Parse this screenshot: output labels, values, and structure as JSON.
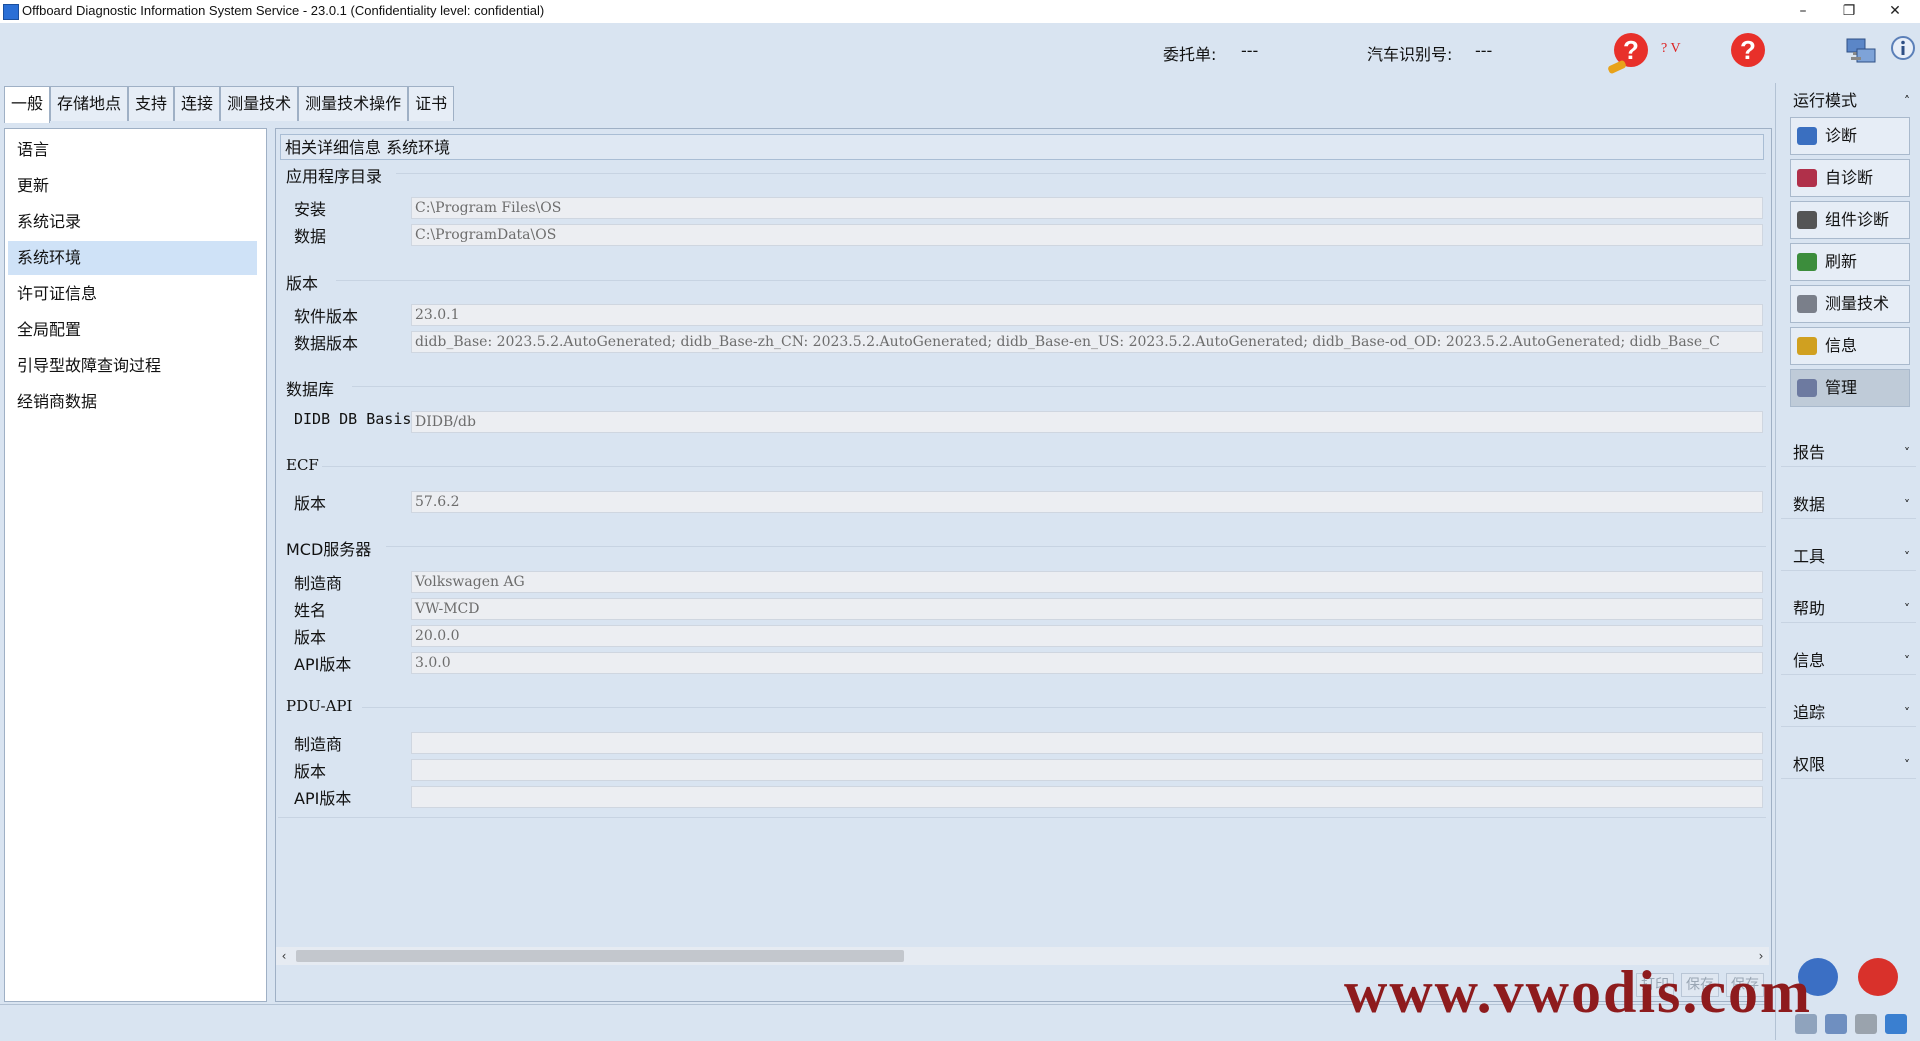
{
  "window": {
    "title": "Offboard Diagnostic Information System Service - 23.0.1 (Confidentiality level: confidential)",
    "minimize": "–",
    "restore": "❐",
    "close": "✕"
  },
  "header": {
    "order_label": "委托单:",
    "order_value": "---",
    "vin_label": "汽车识别号:",
    "vin_value": "---",
    "help_mark": "?",
    "help_suffix": "? V",
    "help2_mark": "?"
  },
  "tabs": [
    "一般",
    "存储地点",
    "支持",
    "连接",
    "测量技术",
    "测量技术操作",
    "证书"
  ],
  "sidebar": {
    "items": [
      "语言",
      "更新",
      "系统记录",
      "系统环境",
      "许可证信息",
      "全局配置",
      "引导型故障查询过程",
      "经销商数据"
    ],
    "active_index": 3
  },
  "main": {
    "breadcrumb": "相关详细信息 系统环境",
    "sections": [
      {
        "title": "应用程序目录",
        "rows": [
          {
            "label": "安装",
            "value": "C:\\Program Files\\OS"
          },
          {
            "label": "数据",
            "value": "C:\\ProgramData\\OS"
          }
        ]
      },
      {
        "title": "版本",
        "rows": [
          {
            "label": "软件版本",
            "value": "23.0.1"
          },
          {
            "label": "数据版本",
            "value": "didb_Base: 2023.5.2.AutoGenerated; didb_Base-zh_CN: 2023.5.2.AutoGenerated; didb_Base-en_US: 2023.5.2.AutoGenerated; didb_Base-od_OD: 2023.5.2.AutoGenerated; didb_Base_C"
          }
        ]
      },
      {
        "title": "数据库",
        "rows": [
          {
            "label": "DIDB DB Basis",
            "value": "DIDB/db"
          }
        ]
      },
      {
        "title": "ECF",
        "rows": [
          {
            "label": "版本",
            "value": "57.6.2"
          }
        ]
      },
      {
        "title": "MCD服务器",
        "rows": [
          {
            "label": "制造商",
            "value": "Volkswagen AG"
          },
          {
            "label": "姓名",
            "value": "VW-MCD"
          },
          {
            "label": "版本",
            "value": "20.0.0"
          },
          {
            "label": "API版本",
            "value": "3.0.0"
          }
        ]
      },
      {
        "title": "PDU-API",
        "rows": [
          {
            "label": "制造商",
            "value": ""
          },
          {
            "label": "版本",
            "value": ""
          },
          {
            "label": "API版本",
            "value": ""
          }
        ]
      }
    ],
    "scroll_left": "‹",
    "scroll_right": "›",
    "bottom_buttons": [
      "打印",
      "保存",
      "保存"
    ]
  },
  "right_panel": {
    "mode_header": "运行模式",
    "collapse_caret": "˄",
    "mode_buttons": [
      {
        "label": "诊断",
        "icon": "diagnosis-icon",
        "color": "#3a6fc0"
      },
      {
        "label": "自诊断",
        "icon": "self-diagnosis-icon",
        "color": "#b0304a"
      },
      {
        "label": "组件诊断",
        "icon": "component-diagnosis-icon",
        "color": "#555555"
      },
      {
        "label": "刷新",
        "icon": "flash-icon",
        "color": "#3c8d3c"
      },
      {
        "label": "测量技术",
        "icon": "measurement-icon",
        "color": "#7a7f8a"
      },
      {
        "label": "信息",
        "icon": "info-book-icon",
        "color": "#d0a020"
      },
      {
        "label": "管理",
        "icon": "admin-gear-icon",
        "color": "#6d7aa0"
      }
    ],
    "active_mode_index": 6,
    "sections": [
      "报告",
      "数据",
      "工具",
      "帮助",
      "信息",
      "追踪",
      "权限"
    ],
    "expand_caret": "˅"
  },
  "watermark": "www.vwodis.com"
}
